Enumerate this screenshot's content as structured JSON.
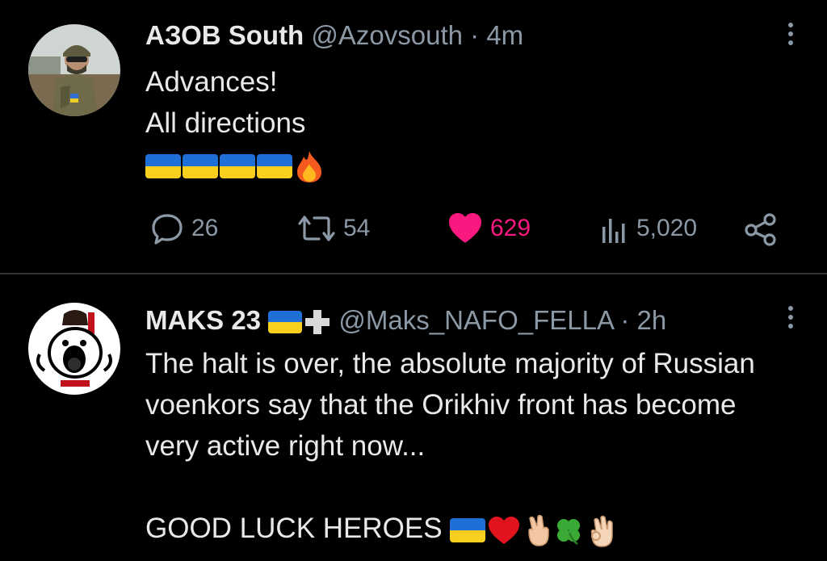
{
  "tweets": [
    {
      "display_name": "АЗОВ South",
      "handle": "@Azovsouth",
      "time": "4m",
      "lines": [
        "Advances!",
        "All directions"
      ],
      "emoji_row": [
        "flag-ukraine",
        "flag-ukraine",
        "flag-ukraine",
        "flag-ukraine",
        "fire"
      ],
      "actions": {
        "replies": "26",
        "retweets": "54",
        "likes": "629",
        "views": "5,020"
      },
      "liked": true
    },
    {
      "display_name": "MAKS 23",
      "name_emoji": [
        "flag-ukraine",
        "heavy-plus"
      ],
      "handle": "@Maks_NAFO_FELLA",
      "time": "2h",
      "text": "The halt is over, the absolute majority of Russian voenkors say that the Orikhiv front has become very active right now...",
      "closing": "GOOD LUCK HEROES",
      "closing_emoji": [
        "flag-ukraine",
        "red-heart",
        "crossed-fingers",
        "four-leaf-clover",
        "ok-hand"
      ]
    }
  ],
  "colors": {
    "background": "#000000",
    "text": "#e7e9ea",
    "secondary": "#8b98a5",
    "like": "#f91880",
    "divider": "#2f3336"
  },
  "dot_separator": "·"
}
